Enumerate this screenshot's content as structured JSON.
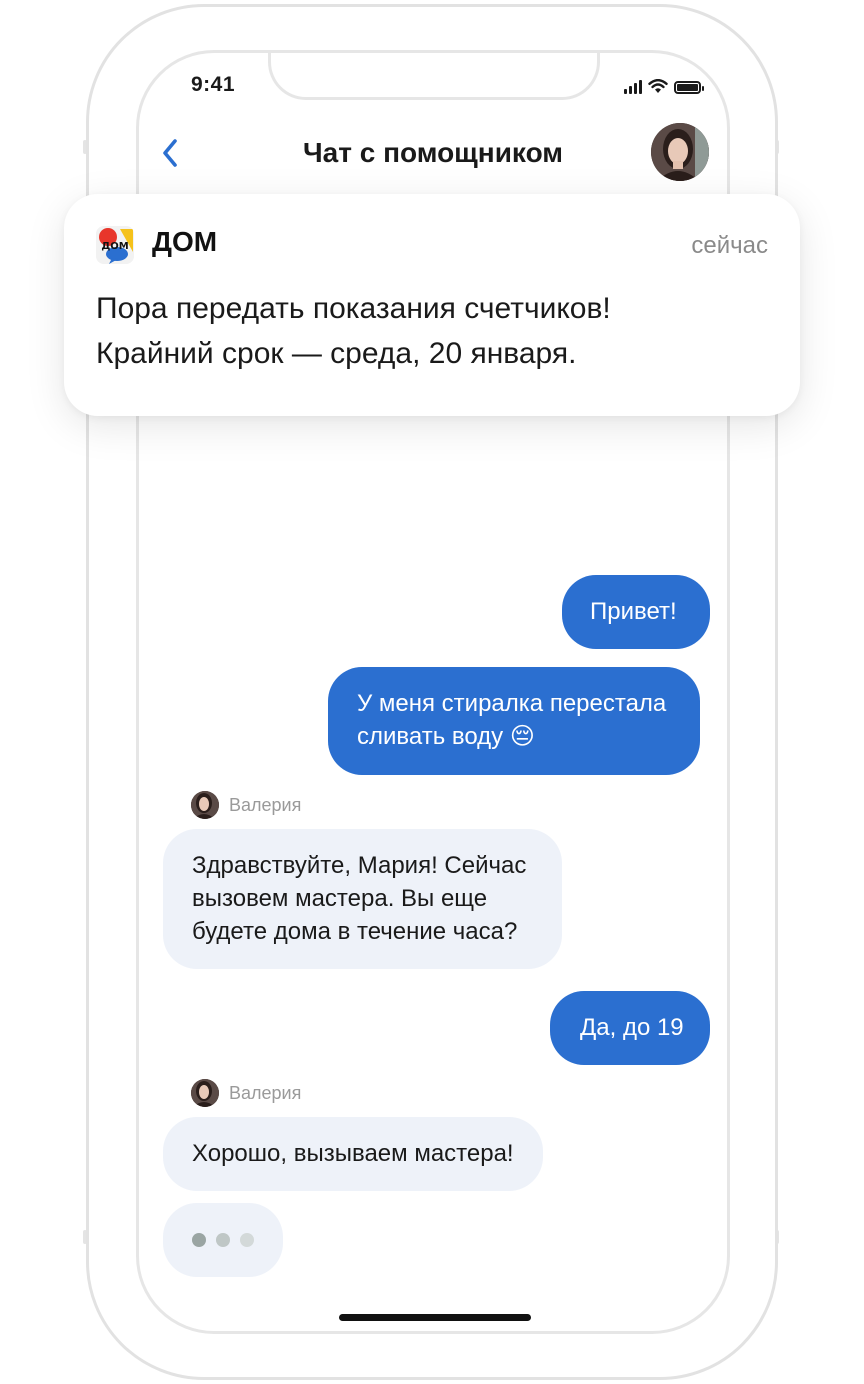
{
  "status_bar": {
    "time": "9:41"
  },
  "header": {
    "title": "Чат с помощником"
  },
  "notification": {
    "app_name": "ДОМ",
    "logo_text": "ДОМ",
    "time": "сейчас",
    "line1": "Пора передать показания счетчиков!",
    "line2": "Крайний срок — среда, 20 января."
  },
  "messages": [
    {
      "direction": "out",
      "text": "Привет!"
    },
    {
      "direction": "out",
      "line1": "У меня стиралка перестала",
      "line2": "сливать воду 😔"
    },
    {
      "direction": "in",
      "sender": "Валерия",
      "line1": "Здравствуйте, Мария! Сейчас",
      "line2": "вызовем мастера. Вы еще",
      "line3": "будете дома в течение часа?"
    },
    {
      "direction": "out",
      "text": "Да, до 19"
    },
    {
      "direction": "in",
      "sender": "Валерия",
      "text": "Хорошо, вызываем мастера!"
    }
  ],
  "colors": {
    "outgoing_bubble": "#2b6fd0",
    "incoming_bubble": "#eef2f9",
    "accent": "#2b6fd0"
  }
}
